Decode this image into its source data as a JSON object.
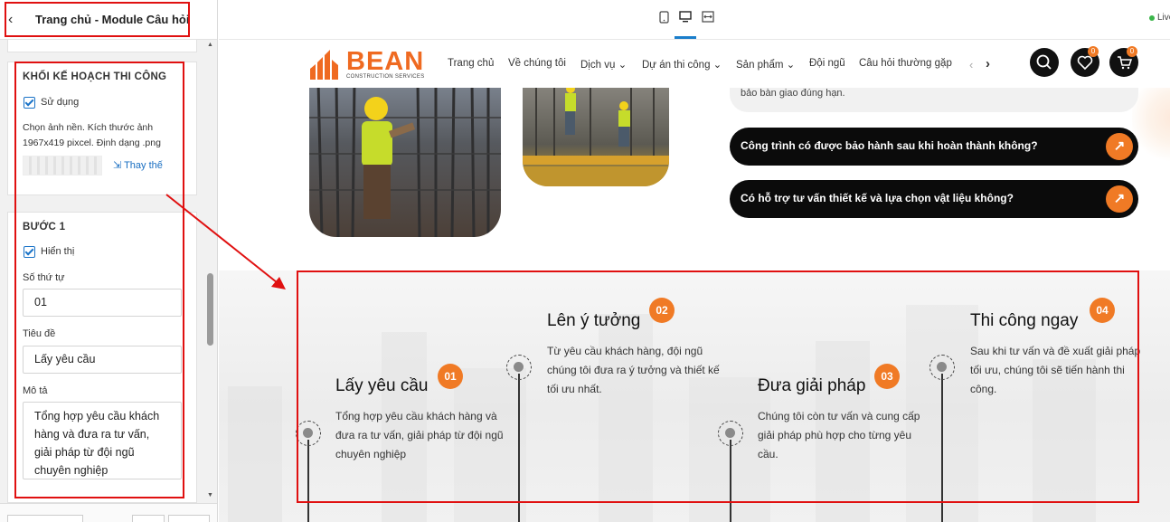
{
  "panel": {
    "title": "Trang chủ - Module Câu hỏi",
    "section1": {
      "title": "KHỐI KẾ HOẠCH THI CÔNG",
      "use_label": "Sử dụng",
      "bg_hint": "Chọn ảnh nền. Kích thước ảnh 1967x419 pixcel. Định dạng .png",
      "replace_label": "Thay thế"
    },
    "section2": {
      "title": "BƯỚC 1",
      "show_label": "Hiển thị",
      "order_label": "Số thứ tự",
      "order_value": "01",
      "title_label": "Tiêu đề",
      "title_value": "Lấy yêu cầu",
      "desc_label": "Mô tả",
      "desc_value": "Tổng hợp yêu cầu khách hàng và đưa ra tư vấn, giải pháp từ đội ngũ chuyên nghiệp"
    }
  },
  "toolbar": {
    "live_label": "Live",
    "devices": [
      "mobile-icon",
      "desktop-icon",
      "fullwidth-icon"
    ]
  },
  "site": {
    "logo_text": "BEAN",
    "logo_sub": "CONSTRUCTION SERVICES",
    "nav": [
      "Trang chủ",
      "Về chúng tôi",
      "Dịch vụ",
      "Dự án thi công",
      "Sản phẩm",
      "Đội ngũ",
      "Câu hỏi thường gặp"
    ],
    "wishlist_count": "0",
    "cart_count": "0",
    "faq_partial": "bảo bàn giao đúng hạn.",
    "faq": [
      "Công trình có được bảo hành sau khi hoàn thành không?",
      "Có hỗ trợ tư vấn thiết kế và lựa chọn vật liệu không?"
    ],
    "steps": [
      {
        "num": "01",
        "title": "Lấy yêu cầu",
        "desc": "Tổng hợp yêu cầu khách hàng và đưa ra tư vấn, giải pháp từ đội ngũ chuyên nghiệp"
      },
      {
        "num": "02",
        "title": "Lên ý tưởng",
        "desc": "Từ yêu cầu khách hàng, đội ngũ chúng tôi đưa ra ý tưởng và thiết kế tối ưu nhất."
      },
      {
        "num": "03",
        "title": "Đưa giải pháp",
        "desc": "Chúng tôi còn tư vấn và cung cấp giải pháp phù hợp cho từng yêu cầu."
      },
      {
        "num": "04",
        "title": "Thi công ngay",
        "desc": "Sau khi tư vấn và đề xuất giải pháp tối ưu, chúng tôi sẽ tiến hành thi công."
      }
    ]
  },
  "colors": {
    "accent": "#f07a25",
    "annotation": "#e01010",
    "link": "#1a6fc2"
  }
}
